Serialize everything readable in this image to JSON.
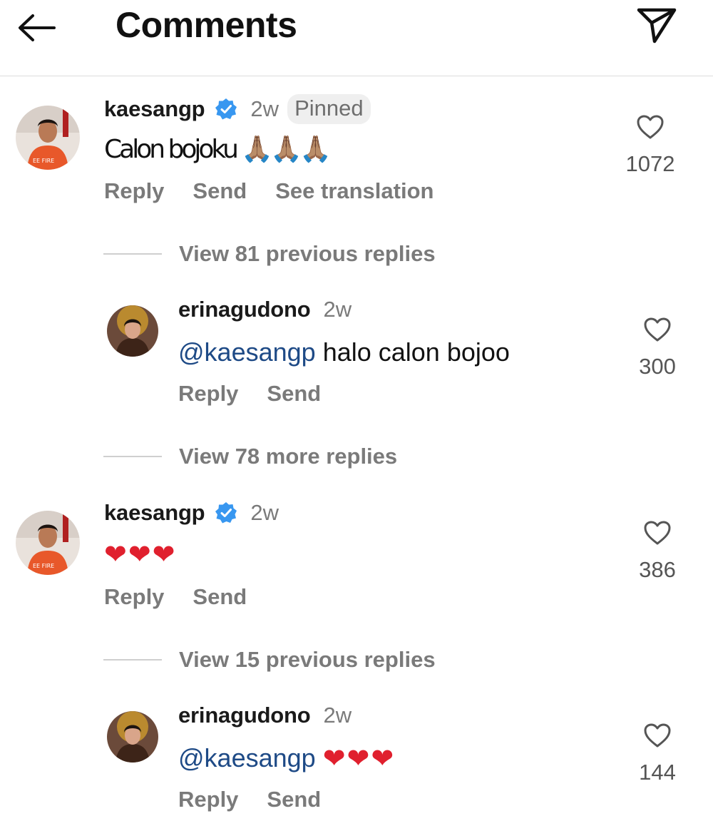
{
  "header": {
    "title": "Comments",
    "back_icon": "back-arrow-icon",
    "send_icon": "paper-plane-icon"
  },
  "comments": [
    {
      "username": "kaesangp",
      "verified": true,
      "time": "2w",
      "pinned_label": "Pinned",
      "text": "Calon bojoku 🙏🏽🙏🏽🙏🏽",
      "actions": [
        "Reply",
        "Send",
        "See translation"
      ],
      "likes": "1072",
      "view_replies": "View 81 previous replies",
      "reply": {
        "username": "erinagudono",
        "time": "2w",
        "mention": "@kaesangp",
        "text": "halo calon bojoo",
        "actions": [
          "Reply",
          "Send"
        ],
        "likes": "300"
      },
      "more_replies": "View 78 more replies"
    },
    {
      "username": "kaesangp",
      "verified": true,
      "time": "2w",
      "text": "❤❤❤",
      "actions": [
        "Reply",
        "Send"
      ],
      "likes": "386",
      "view_replies": "View 15 previous replies",
      "reply": {
        "username": "erinagudono",
        "time": "2w",
        "mention": "@kaesangp",
        "text": "❤❤❤",
        "actions": [
          "Reply",
          "Send"
        ],
        "likes": "144"
      }
    }
  ],
  "colors": {
    "verified_badge": "#3897f0",
    "mention": "#1e4a86",
    "heart": "#e0202e",
    "muted_text": "#7a7a7a"
  }
}
